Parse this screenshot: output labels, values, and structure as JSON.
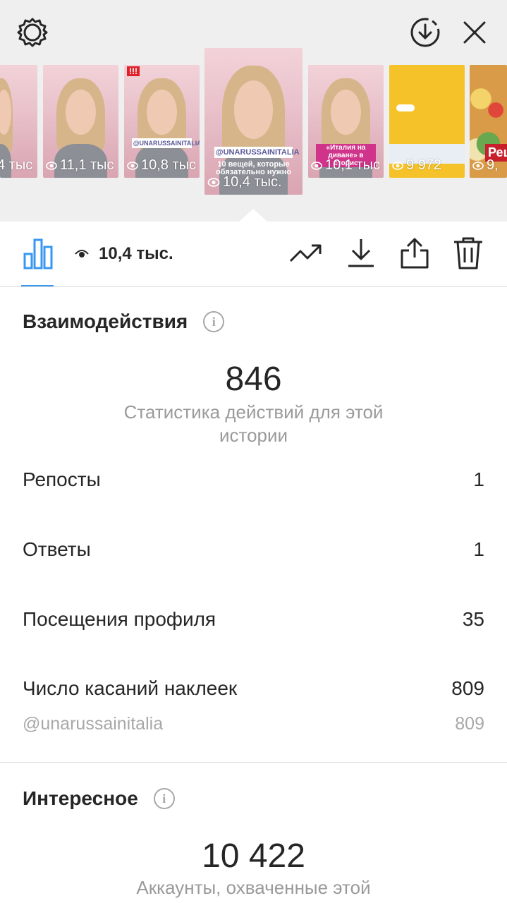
{
  "stories": [
    {
      "views": "4 тыс"
    },
    {
      "views": "11,1 тыс"
    },
    {
      "views": "10,8 тыс",
      "badge": "!!!",
      "tag": "@UNARUSSAINITALIA"
    },
    {
      "views": "10,4 тыс.",
      "tag": "@UNARUSSAINITALIA",
      "caption": "10 вещей, которые обязательно нужно"
    },
    {
      "views": "10,1 тыс",
      "caption": "«Италия на диване» в сторис"
    },
    {
      "views": "9 972"
    },
    {
      "views": "9,",
      "label": "Рец"
    }
  ],
  "toolbar": {
    "views": "10,4 тыс."
  },
  "interactions": {
    "title": "Взаимодействия",
    "total": "846",
    "caption": "Статистика действий для этой истории",
    "rows": [
      {
        "label": "Репосты",
        "value": "1"
      },
      {
        "label": "Ответы",
        "value": "1"
      },
      {
        "label": "Посещения профиля",
        "value": "35"
      },
      {
        "label": "Число касаний наклеек",
        "value": "809"
      }
    ],
    "sticker": {
      "label": "@unarussainitalia",
      "value": "809"
    }
  },
  "discovery": {
    "title": "Интересное",
    "total": "10 422",
    "caption": "Аккаунты, охваченные этой"
  },
  "colors": {
    "accent": "#3897f0",
    "text": "#262626",
    "secondary": "#a8a8a8"
  }
}
